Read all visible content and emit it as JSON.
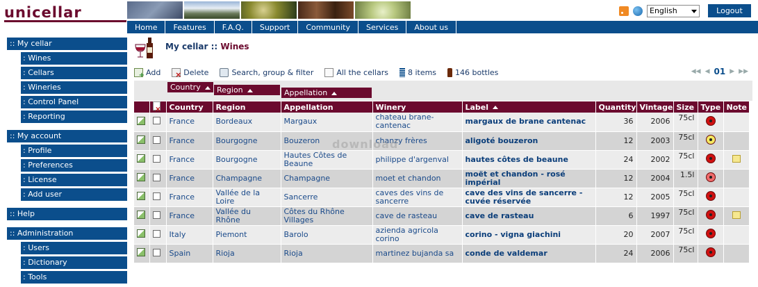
{
  "header": {
    "logo": "unicellar",
    "language": "English",
    "logout_label": "Logout"
  },
  "nav": [
    "Home",
    "Features",
    "F.A.Q.",
    "Support",
    "Community",
    "Services",
    "About us"
  ],
  "sidebar": {
    "sections": [
      {
        "label": ":: My cellar",
        "items": [
          ": Wines",
          ": Cellars",
          ": Wineries",
          ": Control Panel",
          ": Reporting"
        ]
      },
      {
        "label": ":: My account",
        "items": [
          ": Profile",
          ": Preferences",
          ": License",
          ": Add user"
        ]
      },
      {
        "label": ":: Help",
        "items": []
      },
      {
        "label": ":: Administration",
        "items": [
          ": Users",
          ": Dictionary",
          ": Tools"
        ]
      }
    ]
  },
  "breadcrumb": {
    "parent": "My cellar",
    "separator": " :: ",
    "current": "Wines"
  },
  "toolbar": {
    "add": "Add",
    "delete": "Delete",
    "search": "Search, group & filter",
    "all_cellars": "All the cellars",
    "items": "8 items",
    "bottles": "146 bottles",
    "page": "01"
  },
  "groups": [
    "Country",
    "Region",
    "Appellation"
  ],
  "table": {
    "columns": [
      "Country",
      "Region",
      "Appellation",
      "Winery",
      "Label",
      "Quantity",
      "Vintage",
      "Size",
      "Type",
      "Note"
    ],
    "rows": [
      {
        "country": "France",
        "region": "Bordeaux",
        "appellation": "Margaux",
        "winery": "chateau brane-cantenac",
        "label": "margaux de brane cantenac",
        "quantity": "36",
        "vintage": "2006",
        "size": "75cl",
        "type_color": "#d01010",
        "note": false
      },
      {
        "country": "France",
        "region": "Bourgogne",
        "appellation": "Bouzeron",
        "winery": "chanzy frères",
        "label": "aligoté bouzeron",
        "quantity": "12",
        "vintage": "2003",
        "size": "75cl",
        "type_color": "#f4e860",
        "note": false
      },
      {
        "country": "France",
        "region": "Bourgogne",
        "appellation": "Hautes Côtes de Beaune",
        "winery": "philippe d'argenval",
        "label": "hautes côtes de beaune",
        "quantity": "24",
        "vintage": "2002",
        "size": "75cl",
        "type_color": "#d01010",
        "note": true
      },
      {
        "country": "France",
        "region": "Champagne",
        "appellation": "Champagne",
        "winery": "moet et chandon",
        "label": "moët et chandon - rosé impérial",
        "quantity": "12",
        "vintage": "2004",
        "size": "1.5l",
        "type_color": "#f06a6a",
        "note": false
      },
      {
        "country": "France",
        "region": "Vallée de la Loire",
        "appellation": "Sancerre",
        "winery": "caves des vins de sancerre",
        "label": "cave des vins de sancerre - cuvée réservée",
        "quantity": "12",
        "vintage": "2005",
        "size": "75cl",
        "type_color": "#d01010",
        "note": false
      },
      {
        "country": "France",
        "region": "Vallée du Rhône",
        "appellation": "Côtes du Rhône Villages",
        "winery": "cave de rasteau",
        "label": "cave de rasteau",
        "quantity": "6",
        "vintage": "1997",
        "size": "75cl",
        "type_color": "#d01010",
        "note": true
      },
      {
        "country": "Italy",
        "region": "Piemont",
        "appellation": "Barolo",
        "winery": "azienda agricola corino",
        "label": "corino - vigna giachini",
        "quantity": "20",
        "vintage": "2007",
        "size": "75cl",
        "type_color": "#d01010",
        "note": false
      },
      {
        "country": "Spain",
        "region": "Rioja",
        "appellation": "Rioja",
        "winery": "martinez bujanda sa",
        "label": "conde de valdemar",
        "quantity": "24",
        "vintage": "2006",
        "size": "75cl",
        "type_color": "#d01010",
        "note": false
      }
    ]
  },
  "watermark": "download"
}
